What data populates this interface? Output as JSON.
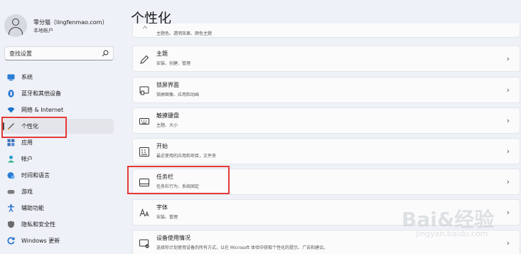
{
  "profile": {
    "name": "零分猫（lingfenmao.com）",
    "account_type": "本地帐户"
  },
  "search": {
    "placeholder": "查找设置"
  },
  "nav": [
    {
      "label": "系统",
      "icon": "monitor-icon",
      "color": "#2b7cd3"
    },
    {
      "label": "蓝牙和其他设备",
      "icon": "bluetooth-icon",
      "color": "#1f6fd0"
    },
    {
      "label": "网络 & Internet",
      "icon": "wifi-icon",
      "color": "#1a73c9"
    },
    {
      "label": "个性化",
      "icon": "brush-icon",
      "color": "#555555",
      "active": true
    },
    {
      "label": "应用",
      "icon": "apps-icon",
      "color": "#3d6fb6"
    },
    {
      "label": "帐户",
      "icon": "person-icon",
      "color": "#2aa0c9"
    },
    {
      "label": "时间和语言",
      "icon": "globe-clock-icon",
      "color": "#2b7cd3"
    },
    {
      "label": "游戏",
      "icon": "gamepad-icon",
      "color": "#7a7a7a"
    },
    {
      "label": "辅助功能",
      "icon": "accessibility-icon",
      "color": "#1f6fd0"
    },
    {
      "label": "隐私和安全性",
      "icon": "shield-icon",
      "color": "#6b6b6b"
    },
    {
      "label": "Windows 更新",
      "icon": "update-icon",
      "color": "#1f6fd0"
    }
  ],
  "main": {
    "title": "个性化",
    "partial_card_sub": "主题色、透明效果、颜色主题",
    "cards": [
      {
        "title": "主题",
        "sub": "安装、创建、管理",
        "icon": "pen-icon"
      },
      {
        "title": "锁屏界面",
        "sub": "锁屏图像、应用和动画",
        "icon": "lock-screen-icon"
      },
      {
        "title": "触摸键盘",
        "sub": "主题、大小",
        "icon": "keyboard-icon"
      },
      {
        "title": "开始",
        "sub": "最近使用的应用和项目，文件夹",
        "icon": "start-icon"
      },
      {
        "title": "任务栏",
        "sub": "任务栏行为、系统固定",
        "icon": "taskbar-icon"
      },
      {
        "title": "字体",
        "sub": "安装、管理",
        "icon": "font-icon"
      },
      {
        "title": "设备使用情况",
        "sub": "选择你计划使用设备的所有方式，以在 Microsoft 体验中获取个性化的提示、广告和建议。",
        "icon": "device-usage-icon"
      }
    ]
  },
  "watermark": {
    "big": "Bai&经验",
    "small": "jingyan.baidu.com"
  },
  "colors": {
    "highlight": "#e53935",
    "background": "#eef1f7",
    "card": "#fbfbfc"
  }
}
